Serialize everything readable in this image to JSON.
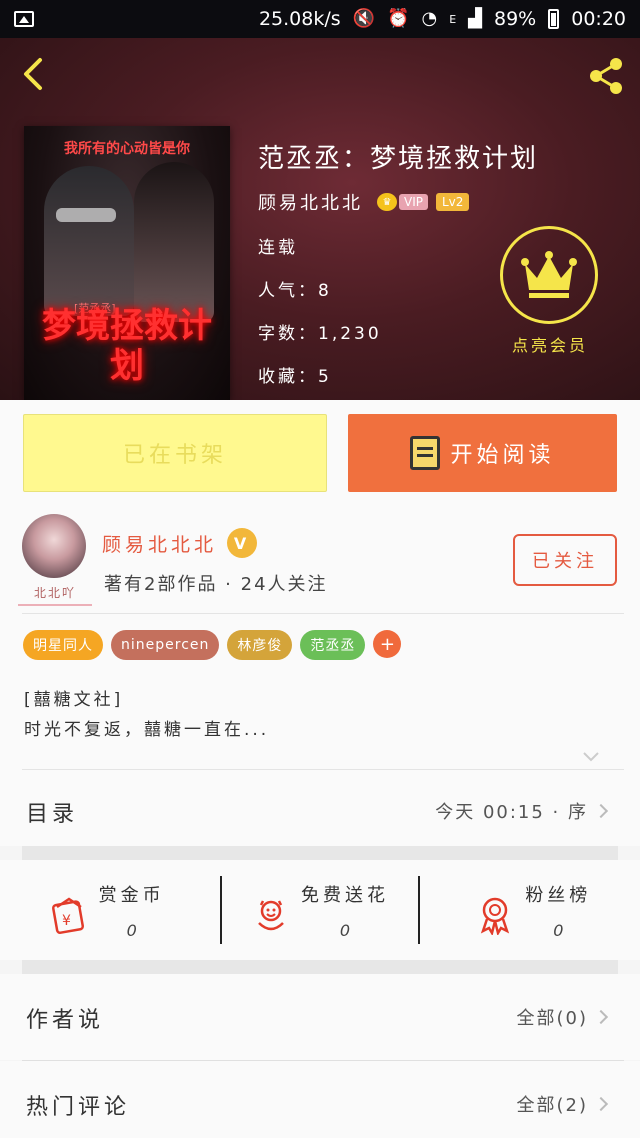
{
  "status_bar": {
    "net_speed": "25.08k/s",
    "signal_e": "E",
    "battery": "89%",
    "time": "00:20"
  },
  "header": {
    "book_title": "范丞丞：梦境拯救计划",
    "author": "顾易北北北",
    "vip_label": "VIP",
    "level": "Lv2",
    "status": "连载",
    "popularity": "人气：8",
    "word_count": "字数：1,230",
    "favorites": "收藏：5",
    "member_label": "点亮会员"
  },
  "cover": {
    "top_text": "我所有的心动皆是你",
    "tag": "[范丞丞]",
    "title": "梦境拯救计划"
  },
  "actions": {
    "shelf_label": "已在书架",
    "read_label": "开始阅读"
  },
  "author_card": {
    "avatar_tag": "北北吖",
    "name": "顾易北北北",
    "verified": "V",
    "meta": "著有2部作品 · 24人关注",
    "follow_label": "已关注"
  },
  "tags": [
    {
      "label": "明星同人",
      "color": "#f5a623"
    },
    {
      "label": "ninepercen",
      "color": "#c4705d"
    },
    {
      "label": "林彦俊",
      "color": "#d4a43a"
    },
    {
      "label": "范丞丞",
      "color": "#6bbf58"
    }
  ],
  "tag_add": "+",
  "description": {
    "line1": "[囍糖文社]",
    "line2": "时光不复返，囍糖一直在..."
  },
  "catalog": {
    "label": "目录",
    "updated": "今天 00:15 · 序"
  },
  "stats": [
    {
      "label": "赏金币",
      "value": "0",
      "icon": "coin-red-envelope-icon"
    },
    {
      "label": "免费送花",
      "value": "0",
      "icon": "flower-icon"
    },
    {
      "label": "粉丝榜",
      "value": "0",
      "icon": "award-ribbon-icon"
    }
  ],
  "author_says": {
    "label": "作者说",
    "right": "全部(0)"
  },
  "hot_comments": {
    "label": "热门评论",
    "right": "全部(2)"
  },
  "colors": {
    "accent_orange": "#f0703e",
    "shelf_yellow": "#fff98f",
    "gold": "#f5e54a",
    "author_red": "#e45a40"
  }
}
